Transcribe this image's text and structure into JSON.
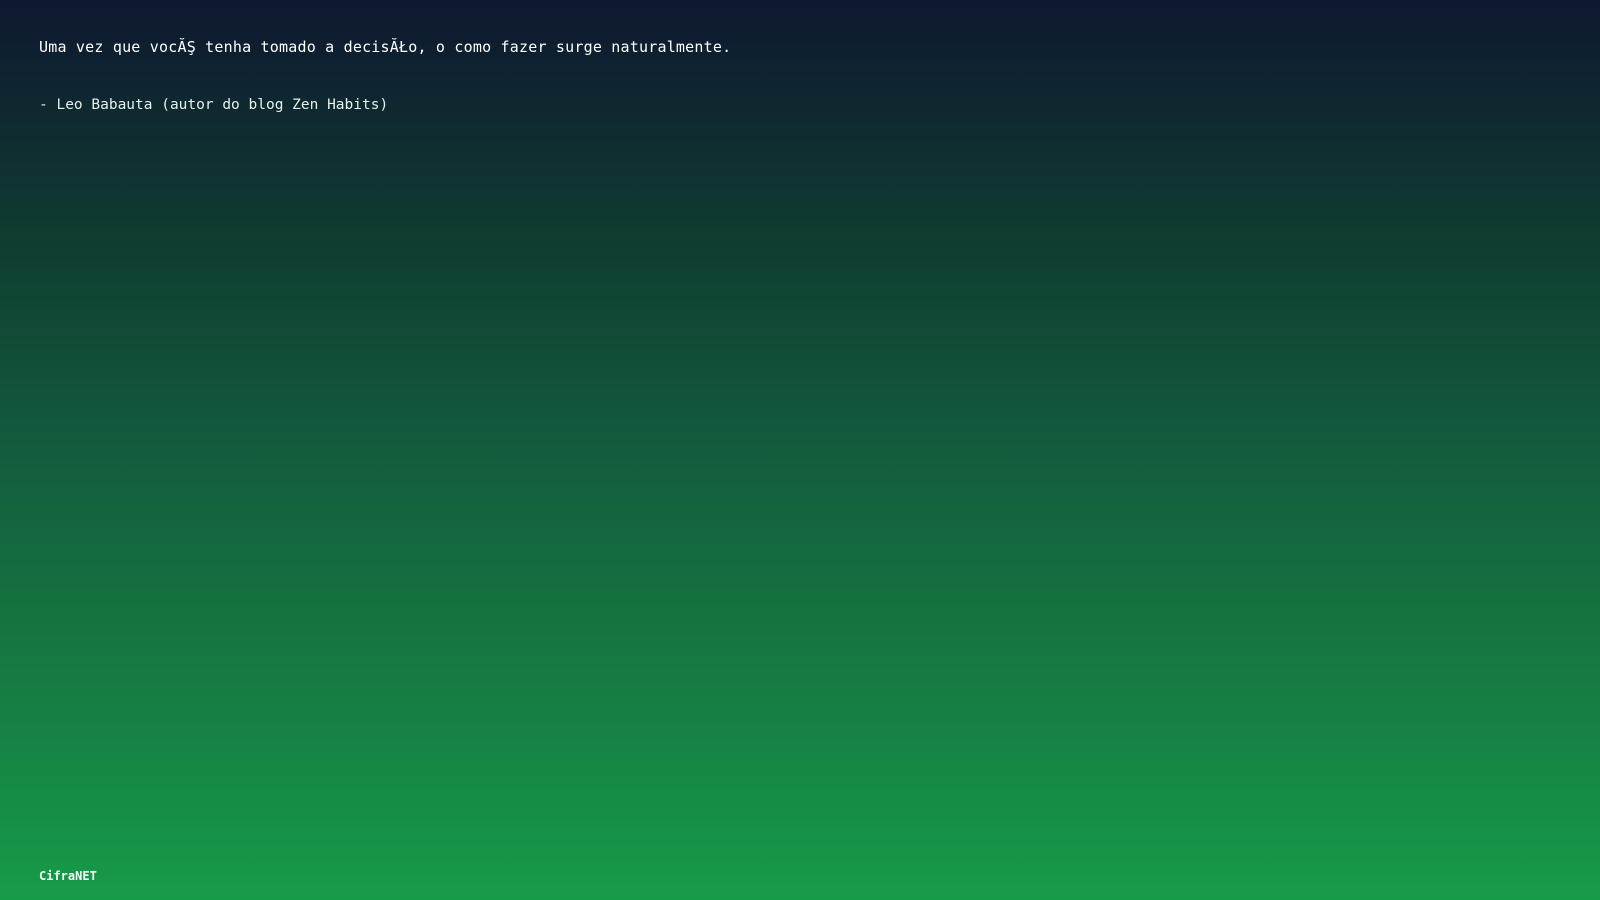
{
  "quote": {
    "text": "Uma vez que vocĂŞ tenha tomado a decisĂŁo, o como fazer surge naturalmente.",
    "author": "- Leo Babauta (autor do blog Zen Habits)"
  },
  "footer": {
    "brand": "CifraNET"
  },
  "colors": {
    "gradient_top": "#0e1830",
    "gradient_bottom": "#169b48",
    "text": "#ffffff"
  }
}
